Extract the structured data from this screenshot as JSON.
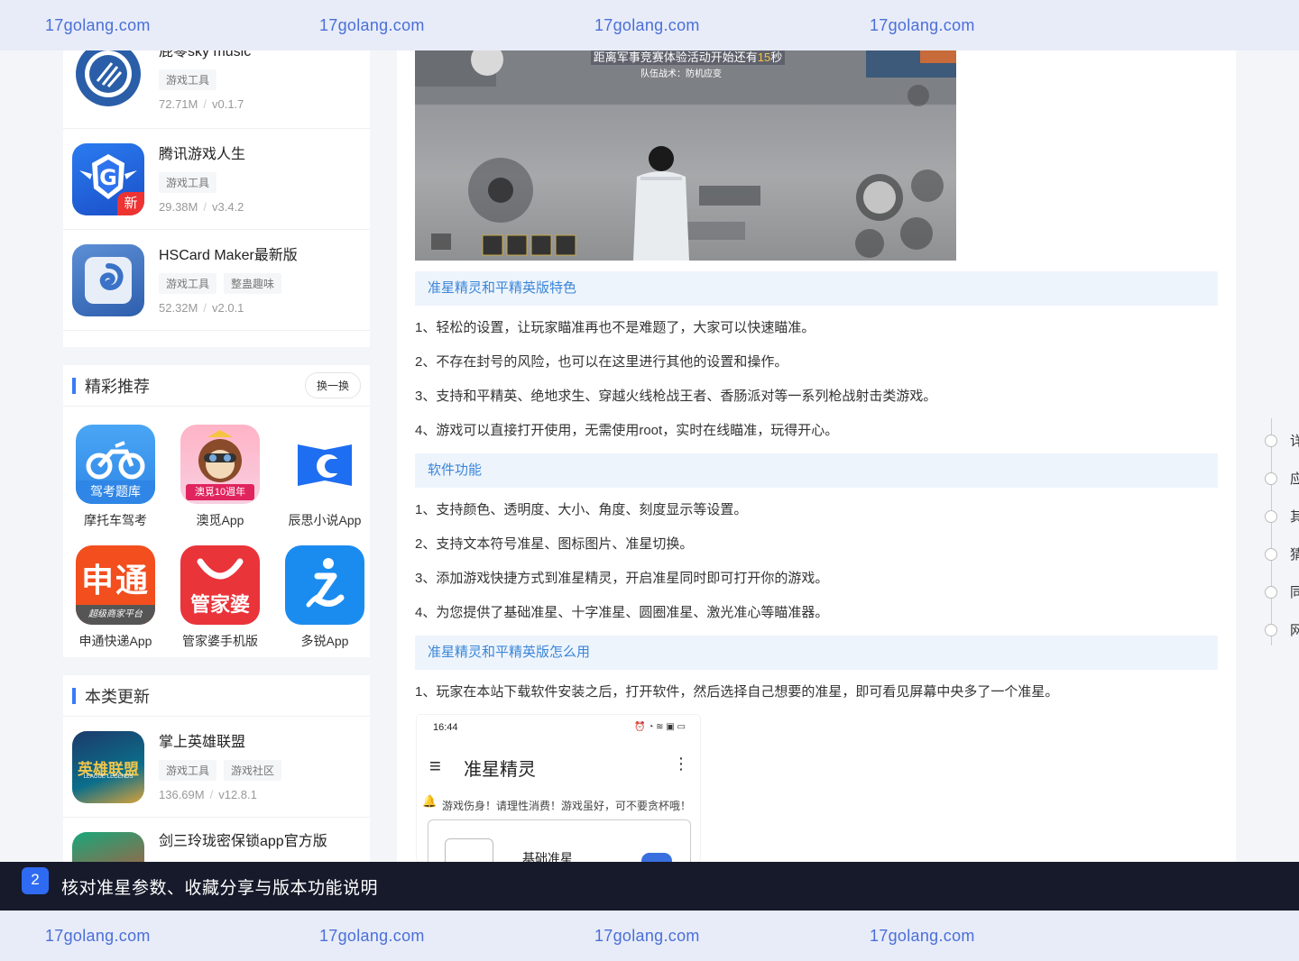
{
  "watermark": {
    "text": "17golang.com"
  },
  "sidebar_top_apps": [
    {
      "name": "屁零sky music",
      "tags": [
        "游戏工具"
      ],
      "size": "72.71M",
      "version": "v0.1.7",
      "icon": "vinyl-record-icon"
    },
    {
      "name": "腾讯游戏人生",
      "tags": [
        "游戏工具"
      ],
      "size": "29.38M",
      "version": "v3.4.2",
      "icon": "tencent-game-life-icon",
      "badge": "新"
    },
    {
      "name": "HSCard Maker最新版",
      "tags": [
        "游戏工具",
        "整蛊趣味"
      ],
      "size": "52.32M",
      "version": "v2.0.1",
      "icon": "hearthstone-swirl-icon"
    }
  ],
  "recommend": {
    "title": "精彩推荐",
    "swap_label": "换一换",
    "items": [
      {
        "name": "摩托车驾考",
        "icon": "motorbike-icon",
        "icon_text": "驾考题库"
      },
      {
        "name": "澳觅App",
        "icon": "raccoon-mascot-icon",
        "icon_text": "澳覓10週年"
      },
      {
        "name": "辰思小说App",
        "icon": "book-c-icon"
      },
      {
        "name": "申通快递App",
        "icon": "sto-express-icon",
        "icon_text": "申通",
        "icon_subtext": "超级商家平台"
      },
      {
        "name": "管家婆手机版",
        "icon": "smile-bag-icon",
        "icon_text": "管家婆"
      },
      {
        "name": "多锐App",
        "icon": "running-figure-icon"
      }
    ]
  },
  "updates": {
    "title": "本类更新",
    "items": [
      {
        "name": "掌上英雄联盟",
        "tags": [
          "游戏工具",
          "游戏社区"
        ],
        "size": "136.69M",
        "version": "v12.8.1",
        "icon": "league-of-legends-icon",
        "icon_text": "英雄联盟",
        "icon_subtext": "LEAGUE·LEGENDS"
      },
      {
        "name": "剑三玲珑密保锁app官方版",
        "icon": "jx3-icon"
      }
    ]
  },
  "game_screenshot": {
    "banner_line1": "距离军事竞赛体验活动开始还有",
    "banner_num": "15",
    "banner_unit": "秒",
    "banner_line2": "队伍战术：",
    "banner_line2b": "防机应变"
  },
  "sections": [
    {
      "heading": "准星精灵和平精英版特色",
      "paragraphs": [
        "1、轻松的设置，让玩家瞄准再也不是难题了，大家可以快速瞄准。",
        "2、不存在封号的风险，也可以在这里进行其他的设置和操作。",
        "3、支持和平精英、绝地求生、穿越火线枪战王者、香肠派对等一系列枪战射击类游戏。",
        "4、游戏可以直接打开使用，无需使用root，实时在线瞄准，玩得开心。"
      ]
    },
    {
      "heading": "软件功能",
      "paragraphs": [
        "1、支持颜色、透明度、大小、角度、刻度显示等设置。",
        "2、支持文本符号准星、图标图片、准星切换。",
        "3、添加游戏快捷方式到准星精灵，开启准星同时即可打开你的游戏。",
        "4、为您提供了基础准星、十字准星、圆圈准星、激光准心等瞄准器。"
      ]
    },
    {
      "heading": "准星精灵和平精英版怎么用",
      "paragraphs": [
        "1、玩家在本站下载软件安装之后，打开软件，然后选择自己想要的准星，即可看见屏幕中央多了一个准星。"
      ]
    }
  ],
  "phone_shot": {
    "time": "16:44",
    "title": "准星精灵",
    "notice": "游戏伤身！请理性消费！游戏虽好，可不要贪杯哦！",
    "row_label": "基础准星"
  },
  "toc": [
    "详",
    "应",
    "其",
    "猜",
    "同",
    "网"
  ],
  "caption": {
    "step": "2",
    "text": "核对准星参数、收藏分享与版本功能说明"
  },
  "colors": {
    "accent": "#3a7bf6",
    "heading_bg": "#eef4fc",
    "heading_text": "#3a86d8",
    "caption_bg": "#161a2a"
  }
}
